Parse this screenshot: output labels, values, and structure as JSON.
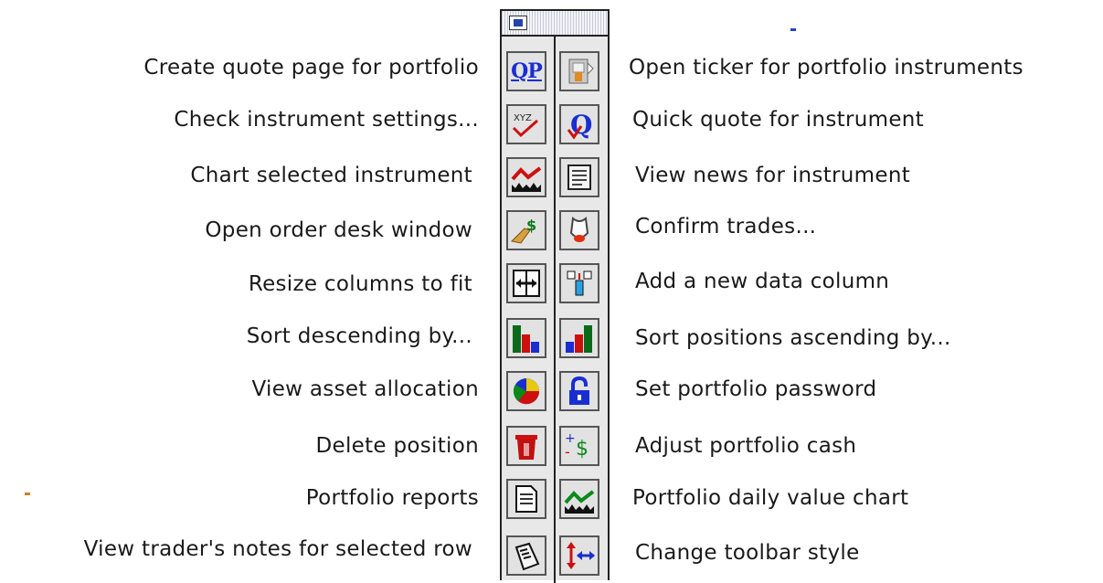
{
  "toolbar": {
    "left_labels": [
      "Create quote page for portfolio",
      "Check instrument settings...",
      "Chart selected instrument",
      "Open order desk window",
      "Resize columns to fit",
      "Sort descending by...",
      "View asset allocation",
      "Delete position",
      "Portfolio reports",
      "View trader's notes for selected row"
    ],
    "right_labels": [
      "Open ticker for portfolio instruments",
      "Quick quote for instrument",
      "View news for instrument",
      "Confirm trades...",
      "Add a new data column",
      "Sort positions ascending by...",
      "Set portfolio password",
      "Adjust portfolio cash",
      "Portfolio daily value chart",
      "Change toolbar style"
    ],
    "qp_text": "QP",
    "xyz_text": "XYZ",
    "q_text": "Q",
    "cash_text": "$"
  },
  "icons": [
    "quote-page-icon",
    "ticker-icon",
    "instrument-settings-icon",
    "quick-quote-icon",
    "chart-icon",
    "news-icon",
    "order-desk-icon",
    "confirm-trades-icon",
    "resize-columns-icon",
    "add-column-icon",
    "sort-descending-icon",
    "sort-ascending-icon",
    "pie-chart-icon",
    "lock-icon",
    "trash-icon",
    "cash-adjust-icon",
    "report-icon",
    "daily-value-chart-icon",
    "notes-icon",
    "toolbar-style-icon"
  ],
  "colors": {
    "blue": "#1a2ed0",
    "red": "#cc1010",
    "green": "#0a7a1a",
    "background": "#ffffff"
  }
}
